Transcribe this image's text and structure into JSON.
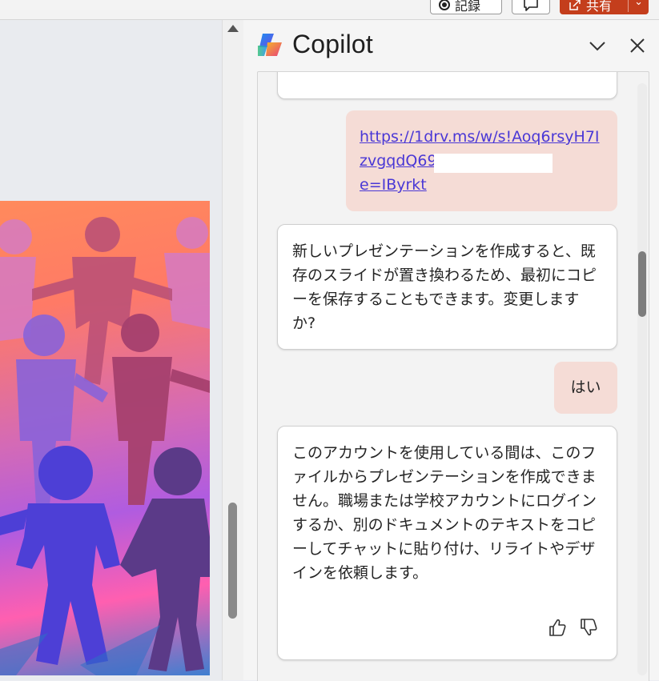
{
  "toolbar": {
    "record_label": "記録",
    "share_label": "共有"
  },
  "copilot": {
    "title": "Copilot",
    "messages": [
      {
        "role": "user",
        "text": "https://1drv.ms/w/s!Aoq6rsyH7IzvgqdQ69",
        "text_end": "e=IByrkt"
      },
      {
        "role": "assistant",
        "text": "新しいプレゼンテーションを作成すると、既存のスライドが置き換わるため、最初にコピーを保存することもできます。変更しますか?"
      },
      {
        "role": "user",
        "text": "はい"
      },
      {
        "role": "assistant",
        "text": "このアカウントを使用している間は、このファイルからプレゼンテーションを作成できません。職場または学校アカウントにログインするか、別のドキュメントのテキストをコピーしてチャットに貼り付け、リライトやデザインを依頼します。"
      }
    ]
  },
  "colors": {
    "share_button": "#c43e1c",
    "user_bubble": "#f5dcd6",
    "link": "#4a38d6"
  },
  "icons": {
    "record": "record-icon",
    "comment": "comment-icon",
    "share": "share-icon",
    "logo": "copilot-logo-icon",
    "collapse": "chevron-down-icon",
    "close": "close-icon",
    "like": "thumbs-up-icon",
    "dislike": "thumbs-down-icon"
  }
}
